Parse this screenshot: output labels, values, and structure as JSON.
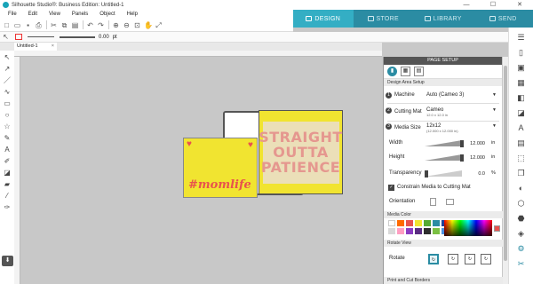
{
  "window": {
    "title": "Silhouette Studio®: Business Edition: Untitled-1",
    "minimize": "—",
    "maximize": "☐",
    "close": "✕"
  },
  "menu": [
    "File",
    "Edit",
    "View",
    "Panels",
    "Object",
    "Help"
  ],
  "top_tabs": [
    {
      "label": "DESIGN",
      "active": true
    },
    {
      "label": "STORE",
      "active": false
    },
    {
      "label": "LIBRARY",
      "active": false
    },
    {
      "label": "SEND",
      "active": false
    }
  ],
  "line_toolbar": {
    "line_width": "0.00",
    "unit": "pt"
  },
  "doc_tab": {
    "label": "Untitled-1",
    "close": "×"
  },
  "canvas": {
    "card1_lines": [
      "STRAIGHT",
      "OUTTA",
      "PATIENCE"
    ],
    "card2_text": "#momlife",
    "heart": "♥",
    "colors": {
      "card": "#f1e430",
      "pink_text": "#e38aa0",
      "red": "#e8524d"
    }
  },
  "page_setup": {
    "title": "PAGE SETUP",
    "section_design_area": "Design Area Setup",
    "machine": {
      "num": "1",
      "label": "Machine",
      "value": "Auto (Cameo 3)"
    },
    "cutting_mat": {
      "num": "2",
      "label": "Cutting Mat",
      "value": "Cameo",
      "sub": "12.0 x 12.0 in"
    },
    "media_size": {
      "num": "3",
      "label": "Media Size",
      "value": "12x12",
      "sub": "(12.000 x 12.000 in)"
    },
    "width": {
      "label": "Width",
      "value": "12.000",
      "unit": "in"
    },
    "height": {
      "label": "Height",
      "value": "12.000",
      "unit": "in"
    },
    "transparency": {
      "label": "Transparency",
      "value": "0.0",
      "unit": "%"
    },
    "constrain": {
      "label": "Constrain Media to Cutting Mat",
      "checked": true
    },
    "orientation_label": "Orientation",
    "media_color_head": "Media Color",
    "swatches": [
      "#ffffff",
      "#ff6a00",
      "#e8524d",
      "#f1e430",
      "#55aa33",
      "#2b8ca3",
      "#1f3f9a",
      "#d9d9d9",
      "#ff9ec2",
      "#8a3cc2",
      "#5a2d82",
      "#2d2d2d",
      "#7bc043",
      "#4a90e2"
    ],
    "rotate_view_head": "Rotate View",
    "rotate_label": "Rotate",
    "print_cut_head": "Print and Cut Borders",
    "dropdown_arrow": "▼"
  }
}
